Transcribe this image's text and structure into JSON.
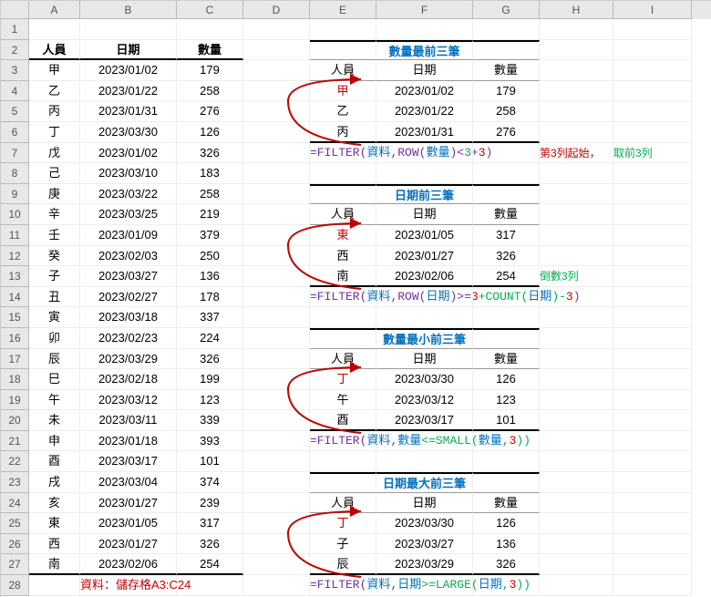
{
  "columns": [
    "A",
    "B",
    "C",
    "D",
    "E",
    "F",
    "G",
    "H",
    "I"
  ],
  "main_headers": {
    "person": "人員",
    "date": "日期",
    "qty": "數量"
  },
  "main_data": [
    [
      "甲",
      "2023/01/02",
      "179"
    ],
    [
      "乙",
      "2023/01/22",
      "258"
    ],
    [
      "丙",
      "2023/01/31",
      "276"
    ],
    [
      "丁",
      "2023/03/30",
      "126"
    ],
    [
      "戊",
      "2023/01/02",
      "326"
    ],
    [
      "己",
      "2023/03/10",
      "183"
    ],
    [
      "庚",
      "2023/03/22",
      "258"
    ],
    [
      "辛",
      "2023/03/25",
      "219"
    ],
    [
      "壬",
      "2023/01/09",
      "379"
    ],
    [
      "癸",
      "2023/02/03",
      "250"
    ],
    [
      "子",
      "2023/03/27",
      "136"
    ],
    [
      "丑",
      "2023/02/27",
      "178"
    ],
    [
      "寅",
      "2023/03/18",
      "337"
    ],
    [
      "卯",
      "2023/02/23",
      "224"
    ],
    [
      "辰",
      "2023/03/29",
      "326"
    ],
    [
      "巳",
      "2023/02/18",
      "199"
    ],
    [
      "午",
      "2023/03/12",
      "123"
    ],
    [
      "未",
      "2023/03/11",
      "339"
    ],
    [
      "申",
      "2023/01/18",
      "393"
    ],
    [
      "酉",
      "2023/03/17",
      "101"
    ],
    [
      "戌",
      "2023/03/04",
      "374"
    ],
    [
      "亥",
      "2023/01/27",
      "239"
    ],
    [
      "東",
      "2023/01/05",
      "317"
    ],
    [
      "西",
      "2023/01/27",
      "326"
    ],
    [
      "南",
      "2023/02/06",
      "254"
    ]
  ],
  "footer_note": "資料：儲存格A3:C24",
  "sections": [
    {
      "title": "數量最前三筆",
      "rows": [
        [
          "甲",
          "2023/01/02",
          "179"
        ],
        [
          "乙",
          "2023/01/22",
          "258"
        ],
        [
          "丙",
          "2023/01/31",
          "276"
        ]
      ],
      "formula_parts": {
        "p1": "=FILTER(",
        "p2": "資料",
        "p3": ",ROW(",
        "p4": "數量",
        "p5": ")<",
        "p6": "3",
        "p7": "+",
        "p8": "3",
        "p9": ")"
      },
      "note1": "第3列起始，",
      "note2": "取前3列"
    },
    {
      "title": "日期前三筆",
      "rows": [
        [
          "東",
          "2023/01/05",
          "317"
        ],
        [
          "西",
          "2023/01/27",
          "326"
        ],
        [
          "南",
          "2023/02/06",
          "254"
        ]
      ],
      "formula_parts": {
        "p1": "=FILTER(",
        "p2": "資料",
        "p3": ",ROW(",
        "p4": "日期",
        "p5": ")>=",
        "p6": "3",
        "p7": "+COUNT(",
        "p8": "日期",
        "p9": ")-",
        "p10": "3",
        "p11": ")"
      },
      "note1": "倒數3列"
    },
    {
      "title": "數量最小前三筆",
      "rows": [
        [
          "丁",
          "2023/03/30",
          "126"
        ],
        [
          "午",
          "2023/03/12",
          "123"
        ],
        [
          "酉",
          "2023/03/17",
          "101"
        ]
      ],
      "formula_parts": {
        "p1": "=FILTER(",
        "p2": "資料",
        "p3": ",",
        "p4": "數量",
        "p5": "<=SMALL(",
        "p6": "數量",
        "p7": ",",
        "p8": "3",
        "p9": "))"
      }
    },
    {
      "title": "日期最大前三筆",
      "rows": [
        [
          "丁",
          "2023/03/30",
          "126"
        ],
        [
          "子",
          "2023/03/27",
          "136"
        ],
        [
          "辰",
          "2023/03/29",
          "326"
        ]
      ],
      "formula_parts": {
        "p1": "=FILTER(",
        "p2": "資料",
        "p3": ",",
        "p4": "日期",
        "p5": ">=LARGE(",
        "p6": "日期",
        "p7": ",",
        "p8": "3",
        "p9": "))"
      }
    }
  ]
}
